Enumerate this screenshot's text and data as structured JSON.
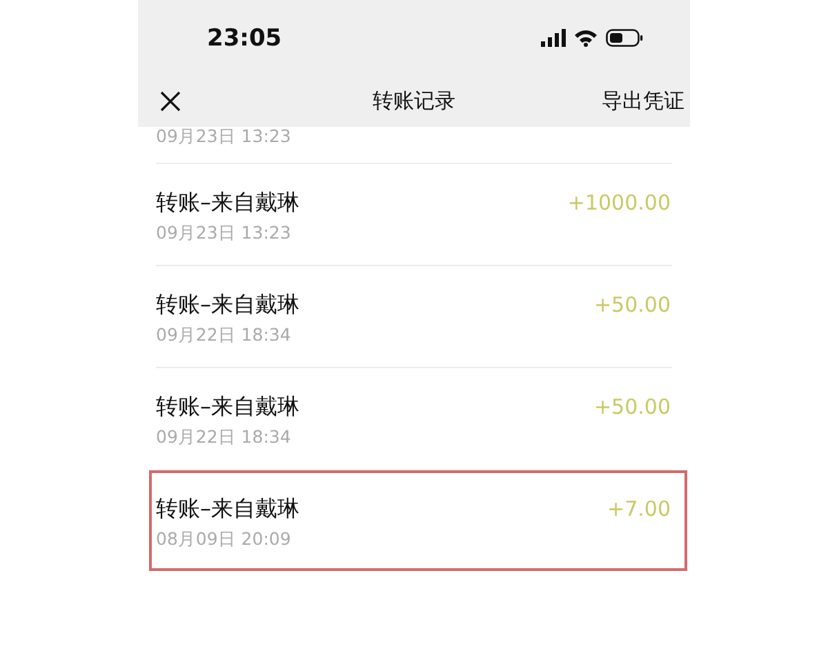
{
  "status_bar": {
    "time": "23:05"
  },
  "nav": {
    "title": "转账记录",
    "action": "导出凭证"
  },
  "partial_row": {
    "date": "09月23日 13:23"
  },
  "transfers": [
    {
      "title": "转账–来自戴琳",
      "date": "09月23日 13:23",
      "amount": "+1000.00",
      "highlighted": false
    },
    {
      "title": "转账–来自戴琳",
      "date": "09月22日 18:34",
      "amount": "+50.00",
      "highlighted": false
    },
    {
      "title": "转账–来自戴琳",
      "date": "09月22日 18:34",
      "amount": "+50.00",
      "highlighted": false
    },
    {
      "title": "转账–来自戴琳",
      "date": "08月09日 20:09",
      "amount": "+7.00",
      "highlighted": true
    }
  ]
}
